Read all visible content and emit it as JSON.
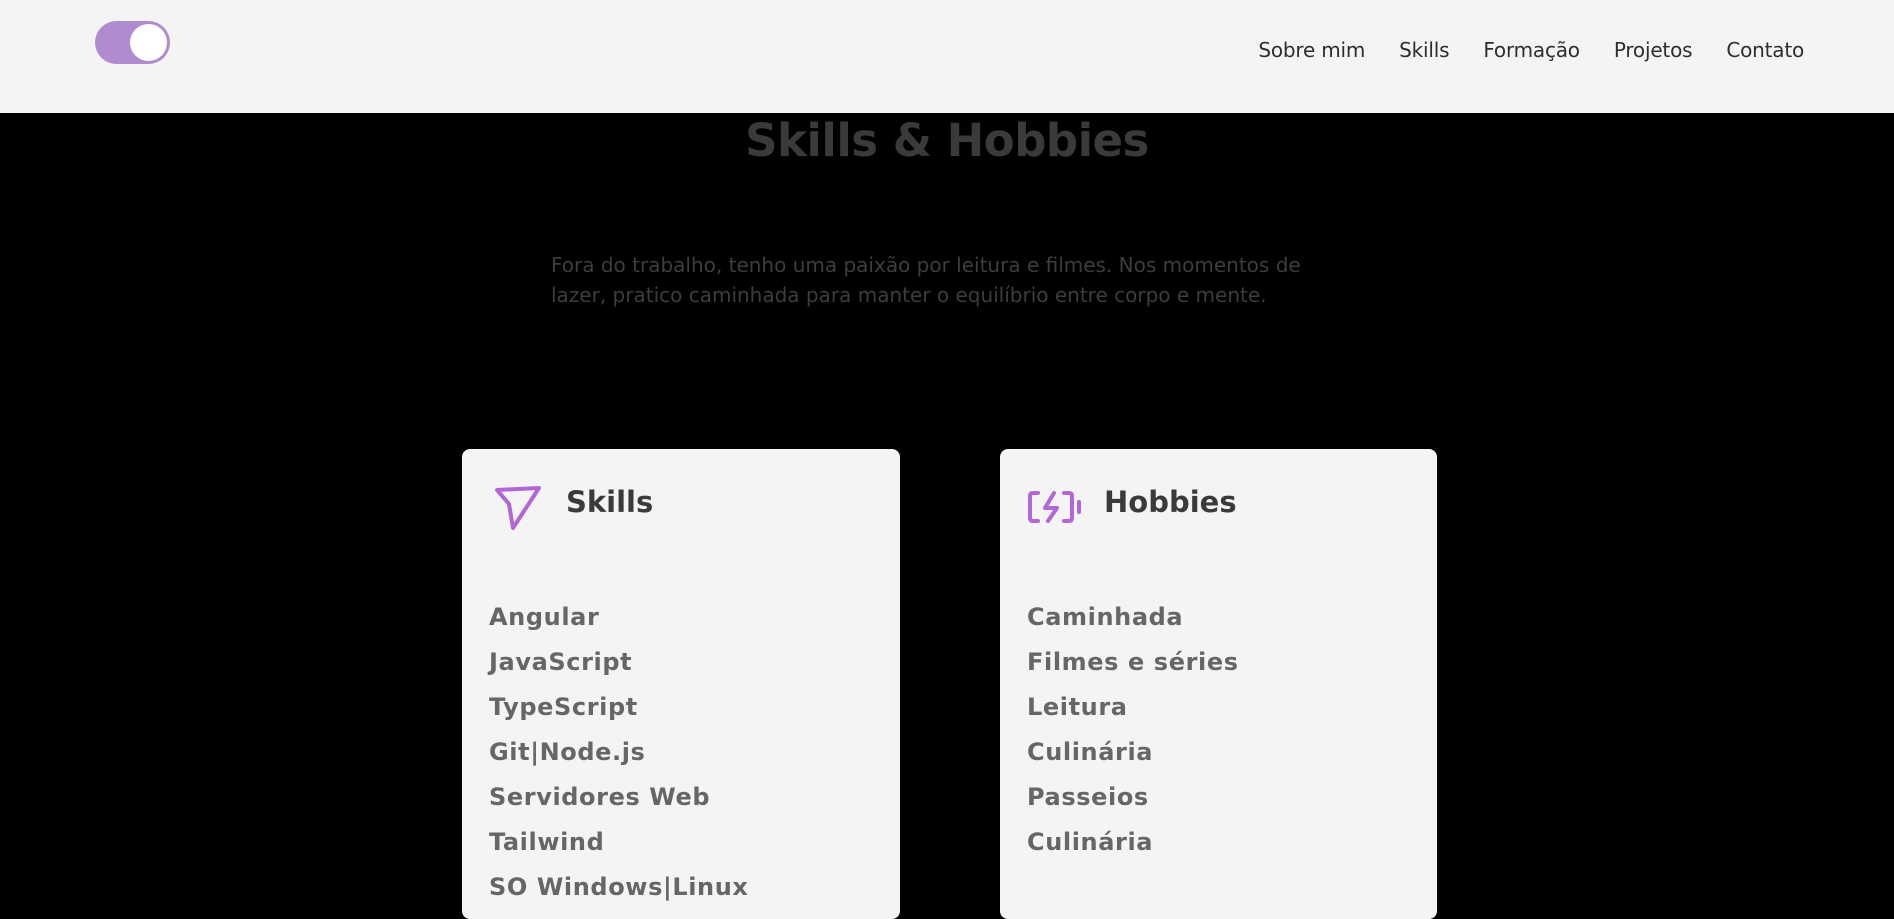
{
  "header": {
    "theme_toggle_state": "on",
    "nav": [
      "Sobre mim",
      "Skills",
      "Formação",
      "Projetos",
      "Contato"
    ]
  },
  "hero": {
    "title": "Skills & Hobbies",
    "description_line1": "Fora do trabalho, tenho uma paixão por leitura e filmes. Nos momentos de",
    "description_line2": "lazer, pratico caminhada para manter o equilíbrio entre corpo e mente."
  },
  "skills_card": {
    "icon": "send-arrow-icon",
    "title": "Skills",
    "items": [
      "Angular",
      "JavaScript",
      "TypeScript",
      "Git|Node.js",
      "Servidores Web",
      "Tailwind",
      "SO Windows|Linux"
    ]
  },
  "hobbies_card": {
    "icon": "battery-charging-icon",
    "title": "Hobbies",
    "items": [
      "Caminhada",
      "Filmes e séries",
      "Leitura",
      "Culinária",
      "Passeios",
      "Culinária"
    ]
  },
  "colors": {
    "accent": "#b366d6",
    "toggle": "#b08ccf",
    "header_bg": "#f4f4f4",
    "page_bg": "#000000"
  }
}
